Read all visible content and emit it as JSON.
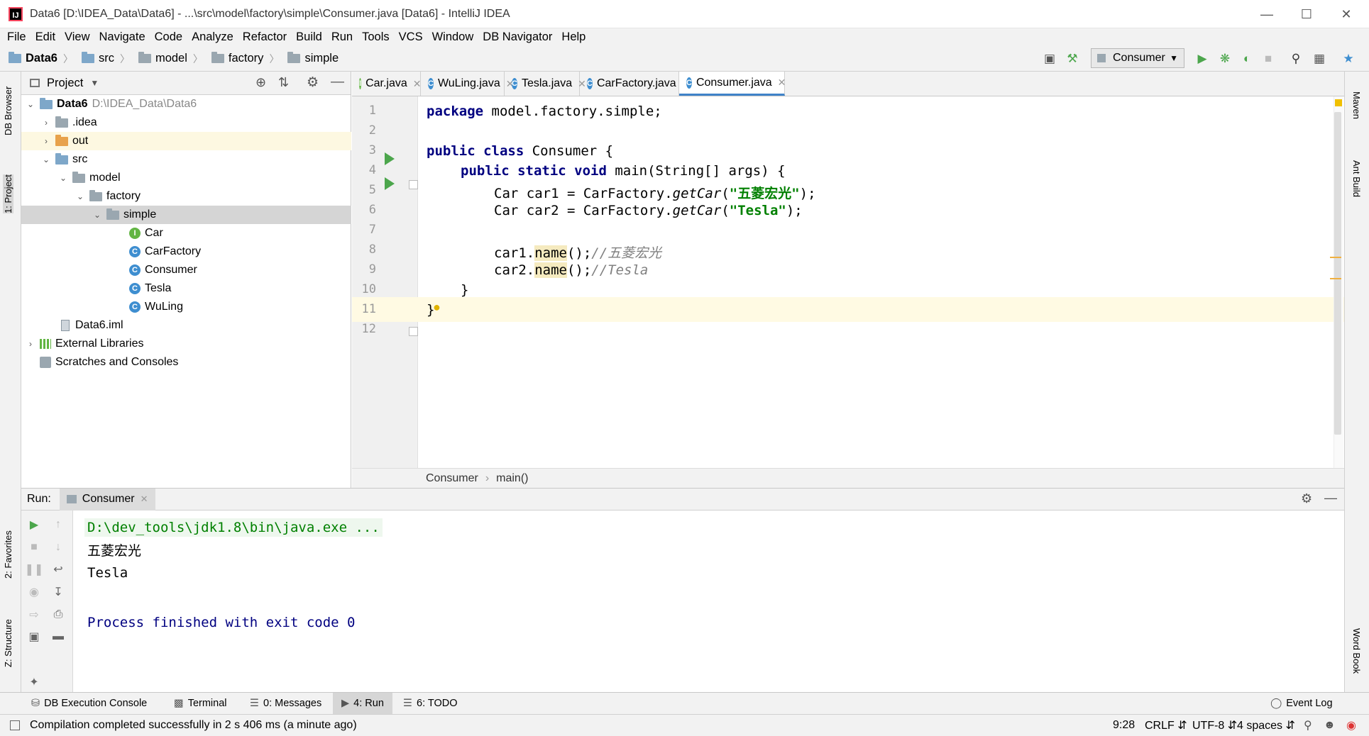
{
  "window": {
    "title": "Data6 [D:\\IDEA_Data\\Data6] - ...\\src\\model\\factory\\simple\\Consumer.java [Data6] - IntelliJ IDEA"
  },
  "menu": [
    "File",
    "Edit",
    "View",
    "Navigate",
    "Code",
    "Analyze",
    "Refactor",
    "Build",
    "Run",
    "Tools",
    "VCS",
    "Window",
    "DB Navigator",
    "Help"
  ],
  "breadcrumb": [
    "Data6",
    "src",
    "model",
    "factory",
    "simple"
  ],
  "run_config": "Consumer",
  "side_left": {
    "db_browser": "DB Browser",
    "project": "1: Project",
    "favorites": "2: Favorites",
    "structure": "Z: Structure"
  },
  "side_right": {
    "maven": "Maven",
    "ant": "Ant Build",
    "wordbook": "Word Book"
  },
  "project": {
    "header": "Project",
    "root_name": "Data6",
    "root_path": "D:\\IDEA_Data\\Data6",
    "items": [
      ".idea",
      "out",
      "src",
      "model",
      "factory",
      "simple",
      "Car",
      "CarFactory",
      "Consumer",
      "Tesla",
      "WuLing",
      "Data6.iml",
      "External Libraries",
      "Scratches and Consoles"
    ]
  },
  "tabs": [
    "Car.java",
    "WuLing.java",
    "Tesla.java",
    "CarFactory.java",
    "Consumer.java"
  ],
  "code": {
    "line_numbers": [
      "1",
      "2",
      "3",
      "4",
      "5",
      "6",
      "7",
      "8",
      "9",
      "10",
      "11",
      "12"
    ],
    "l1_kw": "package",
    "l1_rest": " model.factory.simple;",
    "l3_kw": "public class",
    "l3_rest": " Consumer {",
    "l4_kw": "public static void",
    "l4_rest": " main(String[] args) {",
    "l5_a": "Car car1 = CarFactory.",
    "l5_m": "getCar",
    "l5_b": "(",
    "l5_s": "\"五菱宏光\"",
    "l5_c": ");",
    "l6_a": "Car car2 = CarFactory.",
    "l6_m": "getCar",
    "l6_b": "(",
    "l6_s": "\"Tesla\"",
    "l6_c": ");",
    "l8_a": "car1.",
    "l8_n": "name",
    "l8_b": "();",
    "l8_cm": "//五菱宏光",
    "l9_a": "car2.",
    "l9_n": "name",
    "l9_b": "();",
    "l9_cm": "//Tesla",
    "l10": "}",
    "l11": "}"
  },
  "editor_breadcrumb": {
    "cls": "Consumer",
    "method": "main()"
  },
  "run": {
    "label": "Run:",
    "tab": "Consumer",
    "lines": [
      "D:\\dev_tools\\jdk1.8\\bin\\java.exe ...",
      "五菱宏光",
      "Tesla",
      "Process finished with exit code 0"
    ]
  },
  "bottom_tabs": [
    "DB Execution Console",
    "Terminal",
    "0: Messages",
    "4: Run",
    "6: TODO",
    "Event Log"
  ],
  "status": {
    "message": "Compilation completed successfully in 2 s 406 ms (a minute ago)",
    "position": "9:28",
    "line_sep": "CRLF",
    "encoding": "UTF-8",
    "indent": "4 spaces"
  },
  "colors": {
    "keyword": "#000080",
    "string": "#008000",
    "comment": "#808080",
    "run_green": "#4ca64c",
    "accent": "#4083c9"
  }
}
